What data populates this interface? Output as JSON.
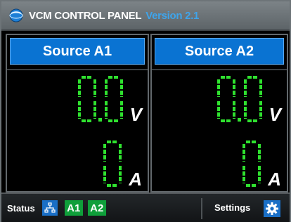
{
  "window": {
    "title": "VCM CONTROL PANEL",
    "version": "Version 2.1",
    "logo_icon": "globe-icon"
  },
  "colors": {
    "digit_on": "#2fe22f",
    "header_blue": "#0a73d2",
    "badge_green": "#0f9f3a",
    "version_blue": "#3fa4ea"
  },
  "channels": [
    {
      "name": "Source A1",
      "voltage": "0.0",
      "voltage_unit": "V",
      "current": "0",
      "current_unit": "A"
    },
    {
      "name": "Source A2",
      "voltage": "0.0",
      "voltage_unit": "V",
      "current": "0",
      "current_unit": "A"
    }
  ],
  "statusbar": {
    "status_label": "Status",
    "network_icon": "network-icon",
    "badges": [
      "A1",
      "A2"
    ],
    "settings_label": "Settings",
    "settings_icon": "gear-icon"
  }
}
